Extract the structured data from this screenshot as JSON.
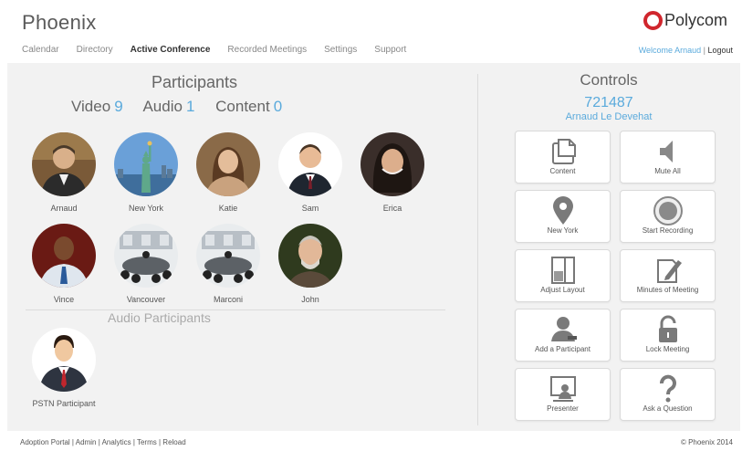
{
  "app": {
    "title": "Phoenix",
    "brand": "Polycom"
  },
  "nav": {
    "items": [
      {
        "label": "Calendar"
      },
      {
        "label": "Directory"
      },
      {
        "label": "Active Conference"
      },
      {
        "label": "Recorded Meetings"
      },
      {
        "label": "Settings"
      },
      {
        "label": "Support"
      }
    ],
    "active": "Active Conference"
  },
  "user": {
    "welcome": "Welcome Arnaud",
    "separator": "|",
    "logout": "Logout"
  },
  "participants": {
    "title": "Participants",
    "counts": [
      {
        "label": "Video",
        "value": "9"
      },
      {
        "label": "Audio",
        "value": "1"
      },
      {
        "label": "Content",
        "value": "0"
      }
    ],
    "video": [
      {
        "name": "Arnaud",
        "icon": "person-photo-icon"
      },
      {
        "name": "New York",
        "icon": "statue-of-liberty-icon"
      },
      {
        "name": "Katie",
        "icon": "person-photo-icon"
      },
      {
        "name": "Sam",
        "icon": "person-photo-icon"
      },
      {
        "name": "Erica",
        "icon": "person-photo-icon"
      },
      {
        "name": "Vince",
        "icon": "person-photo-icon"
      },
      {
        "name": "Vancouver",
        "icon": "conference-room-icon"
      },
      {
        "name": "Marconi",
        "icon": "conference-room-icon"
      },
      {
        "name": "John",
        "icon": "person-photo-icon"
      }
    ],
    "audio_title": "Audio Participants",
    "audio": [
      {
        "name": "PSTN Participant",
        "icon": "businessman-avatar-icon"
      }
    ]
  },
  "controls": {
    "title": "Controls",
    "conference_id": "721487",
    "host": "Arnaud Le Devehat",
    "buttons": [
      {
        "label": "Content",
        "icon": "content-share-icon"
      },
      {
        "label": "Mute All",
        "icon": "speaker-mute-icon"
      },
      {
        "label": "New York",
        "icon": "location-pin-icon"
      },
      {
        "label": "Start Recording",
        "icon": "record-icon"
      },
      {
        "label": "Adjust Layout",
        "icon": "layout-icon"
      },
      {
        "label": "Minutes of Meeting",
        "icon": "pencil-note-icon"
      },
      {
        "label": "Add a Participant",
        "icon": "add-person-icon"
      },
      {
        "label": "Lock Meeting",
        "icon": "padlock-icon"
      },
      {
        "label": "Presenter",
        "icon": "presenter-screen-icon"
      },
      {
        "label": "Ask a Question",
        "icon": "question-mark-icon"
      }
    ]
  },
  "footer": {
    "links": [
      {
        "label": "Adoption Portal"
      },
      {
        "label": "Admin"
      },
      {
        "label": "Analytics"
      },
      {
        "label": "Terms"
      },
      {
        "label": "Reload"
      }
    ],
    "copyright": "© Phoenix 2014"
  },
  "colors": {
    "accent": "#5aaadc",
    "panel": "#f2f2f2",
    "brand_red": "#d0262d"
  }
}
